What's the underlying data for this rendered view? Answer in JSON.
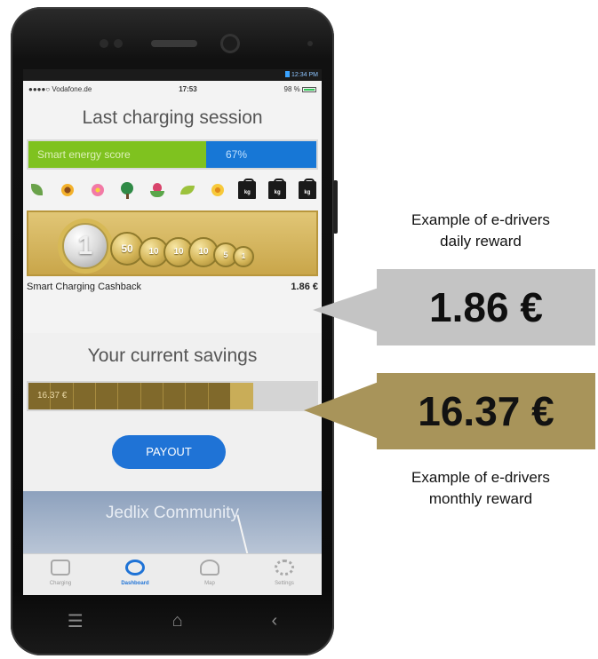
{
  "android_status": {
    "time": "12:34 PM"
  },
  "ios_status": {
    "carrier": "●●●●○ Vodafone.de",
    "time": "17:53",
    "battery": "98 %"
  },
  "last_session": {
    "title": "Last charging session",
    "score_label": "Smart energy score",
    "score_value": "67%",
    "reward_icons": [
      "leaf-icon",
      "sunflower-icon",
      "pink-flower-icon",
      "tree-icon",
      "tulip-icon",
      "sprout-icon",
      "daisy-icon",
      "weight-kg-icon",
      "weight-kg-icon",
      "weight-kg-icon"
    ],
    "weight_label": "kg",
    "coins": [
      "1",
      "50",
      "10",
      "10",
      "10",
      "5",
      "1"
    ],
    "cashback_label": "Smart Charging Cashback",
    "cashback_value": "1.86 €"
  },
  "savings": {
    "title": "Your current savings",
    "amount": "16.37 €",
    "fill_fraction": 0.78,
    "payout_label": "PAYOUT"
  },
  "community": {
    "label": "Jedlix Community"
  },
  "tabs": [
    {
      "label": "Charging",
      "active": false
    },
    {
      "label": "Dashboard",
      "active": true
    },
    {
      "label": "Map",
      "active": false
    },
    {
      "label": "Settings",
      "active": false
    }
  ],
  "navbar": {
    "menu": "☰",
    "home": "⌂",
    "back": "‹"
  },
  "annotations": {
    "daily_caption_1": "Example of e-drivers",
    "daily_caption_2": "daily reward",
    "daily_value": "1.86 €",
    "monthly_value": "16.37 €",
    "monthly_caption_1": "Example of e-drivers",
    "monthly_caption_2": "monthly reward"
  },
  "colors": {
    "score_green": "#7fc21f",
    "score_blue": "#1777d6",
    "savings_gold": "#80692b",
    "daily_box": "#c4c4c4",
    "monthly_box": "#a8945a",
    "payout_blue": "#1f73d6"
  }
}
